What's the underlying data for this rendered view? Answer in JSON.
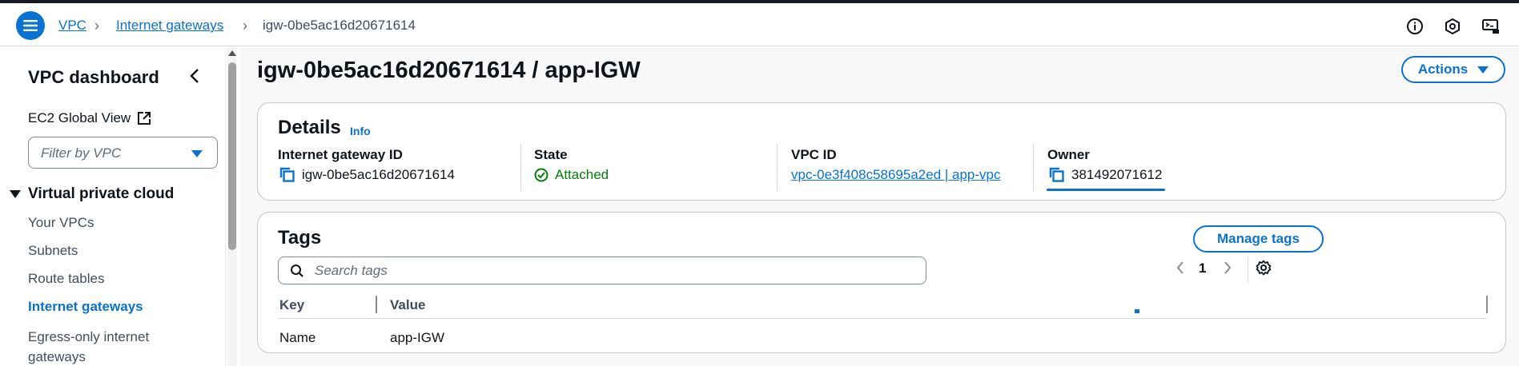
{
  "header": {
    "breadcrumbs": [
      "VPC",
      "Internet gateways",
      "igw-0be5ac16d20671614"
    ],
    "icons": [
      "info-circle-icon",
      "cloudshell-icon",
      "notifications-icon"
    ]
  },
  "sidebar": {
    "title": "VPC dashboard",
    "ec2_global_view": "EC2 Global View",
    "filter_placeholder": "Filter by VPC",
    "section_title": "Virtual private cloud",
    "items": [
      {
        "label": "Your VPCs"
      },
      {
        "label": "Subnets"
      },
      {
        "label": "Route tables"
      },
      {
        "label": "Internet gateways",
        "active": true
      },
      {
        "label": "Egress-only internet gateways"
      }
    ]
  },
  "main": {
    "title": "igw-0be5ac16d20671614 / app-IGW",
    "actions_label": "Actions",
    "details": {
      "heading": "Details",
      "info_label": "Info",
      "fields": [
        {
          "label": "Internet gateway ID",
          "value": "igw-0be5ac16d20671614"
        },
        {
          "label": "State",
          "value": "Attached"
        },
        {
          "label": "VPC ID",
          "value": "vpc-0e3f408c58695a2ed | app-vpc"
        },
        {
          "label": "Owner",
          "value": "381492071612"
        }
      ]
    },
    "tags": {
      "heading": "Tags",
      "manage_label": "Manage tags",
      "search_placeholder": "Search tags",
      "page": "1",
      "columns": [
        "Key",
        "Value"
      ],
      "rows": [
        {
          "key": "Name",
          "value": "app-IGW"
        }
      ]
    }
  },
  "colors": {
    "accent": "#0972d3",
    "success": "#037f0c",
    "text": "#0f141a"
  }
}
